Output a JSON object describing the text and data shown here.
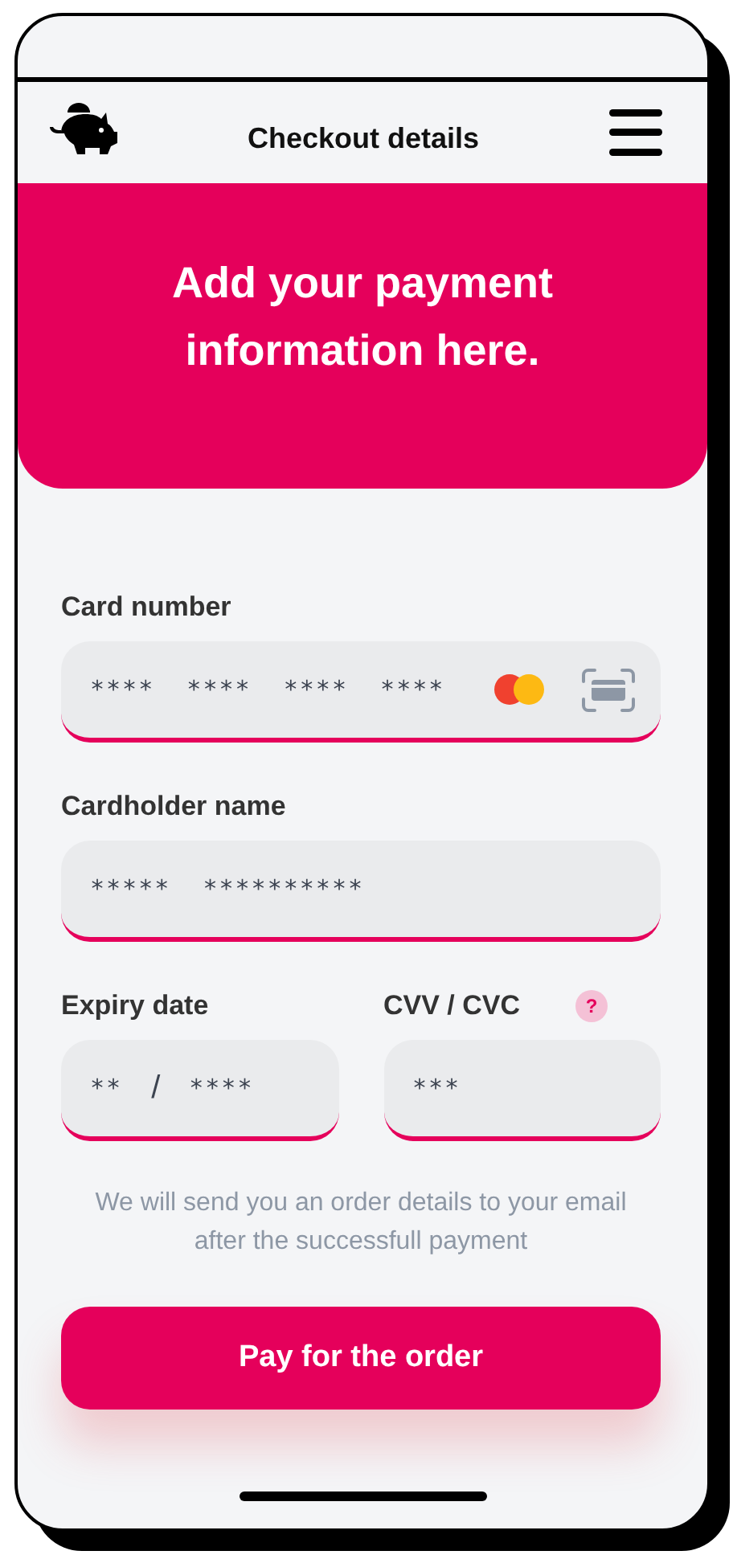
{
  "header": {
    "title": "Checkout details"
  },
  "banner": {
    "heading": "Add your payment information here."
  },
  "card_number": {
    "label": "Card number",
    "value": "****  ****  ****  ****"
  },
  "cardholder_name": {
    "label": "Cardholder name",
    "value": "*****  **********"
  },
  "expiry_date": {
    "label": "Expiry date",
    "month": "**",
    "separator": "/",
    "year": "****"
  },
  "cvv": {
    "label": "CVV / CVC",
    "help": "?",
    "value": "***"
  },
  "note": "We will send you an order details to your email after the successfull payment",
  "pay_button": "Pay for the order"
}
